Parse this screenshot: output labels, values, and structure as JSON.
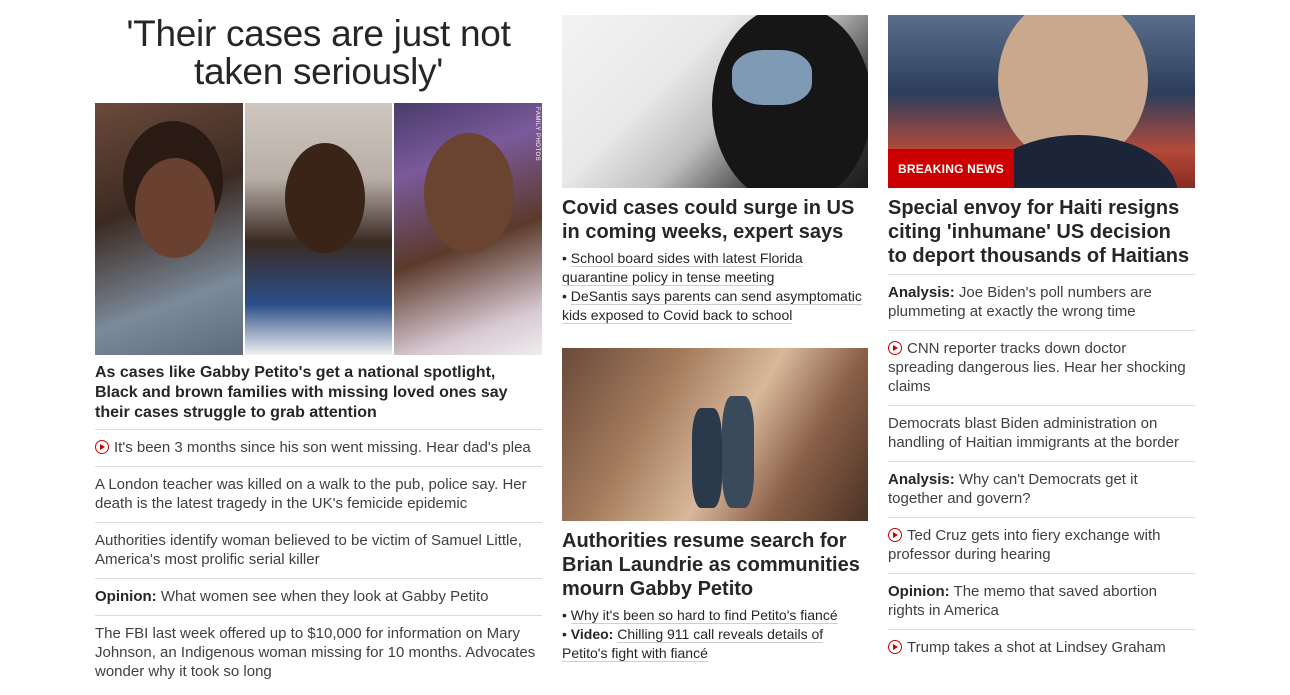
{
  "col1": {
    "headline": "'Their cases are just not taken seriously'",
    "photo_credit": "FAMILY PHOTOS",
    "lead": "As cases like Gabby Petito's get a national spotlight, Black and brown families with missing loved ones say their cases struggle to grab attention",
    "items": [
      {
        "prefix": "",
        "text": "It's been 3 months since his son went missing. Hear dad's plea",
        "video": true
      },
      {
        "prefix": "",
        "text": "A London teacher was killed on a walk to the pub, police say. Her death is the latest tragedy in the UK's femicide epidemic",
        "video": false
      },
      {
        "prefix": "",
        "text": "Authorities identify woman believed to be victim of Samuel Little, America's most prolific serial killer",
        "video": false
      },
      {
        "prefix": "Opinion:",
        "text": " What women see when they look at Gabby Petito",
        "video": false
      },
      {
        "prefix": "",
        "text": "The FBI last week offered up to $10,000 for information on Mary Johnson, an Indigenous woman missing for 10 months. Advocates wonder why it took so long",
        "video": false
      }
    ]
  },
  "col2": {
    "story1": {
      "headline": "Covid cases could surge in US in coming weeks, expert says",
      "sub1": "School board sides with latest Florida quarantine policy in tense meeting",
      "sub2": "DeSantis says parents can send asymptomatic kids exposed to Covid back to school"
    },
    "story2": {
      "headline": "Authorities resume search for Brian Laundrie as communities mourn Gabby Petito",
      "sub1": "Why it's been so hard to find Petito's fiancé",
      "sub2_prefix": "Video:",
      "sub2": "Chilling 911 call reveals details of Petito's fight with fiancé"
    }
  },
  "col3": {
    "badge": "BREAKING NEWS",
    "headline": "Special envoy for Haiti resigns citing 'inhumane' US decision to deport thousands of Haitians",
    "items": [
      {
        "prefix": "Analysis:",
        "text": " Joe Biden's poll numbers are plummeting at exactly the wrong time",
        "video": false
      },
      {
        "prefix": "",
        "text": "CNN reporter tracks down doctor spreading dangerous lies. Hear her shocking claims",
        "video": true
      },
      {
        "prefix": "",
        "text": "Democrats blast Biden administration on handling of Haitian immigrants at the border",
        "video": false
      },
      {
        "prefix": "Analysis:",
        "text": " Why can't Democrats get it together and govern?",
        "video": false
      },
      {
        "prefix": "",
        "text": "Ted Cruz gets into fiery exchange with professor during hearing",
        "video": true
      },
      {
        "prefix": "Opinion:",
        "text": " The memo that saved abortion rights in America",
        "video": false
      },
      {
        "prefix": "",
        "text": "Trump takes a shot at Lindsey Graham",
        "video": true
      }
    ]
  },
  "colors": {
    "accent": "#cc0000",
    "text": "#262626",
    "divider": "#dcdcdc"
  }
}
